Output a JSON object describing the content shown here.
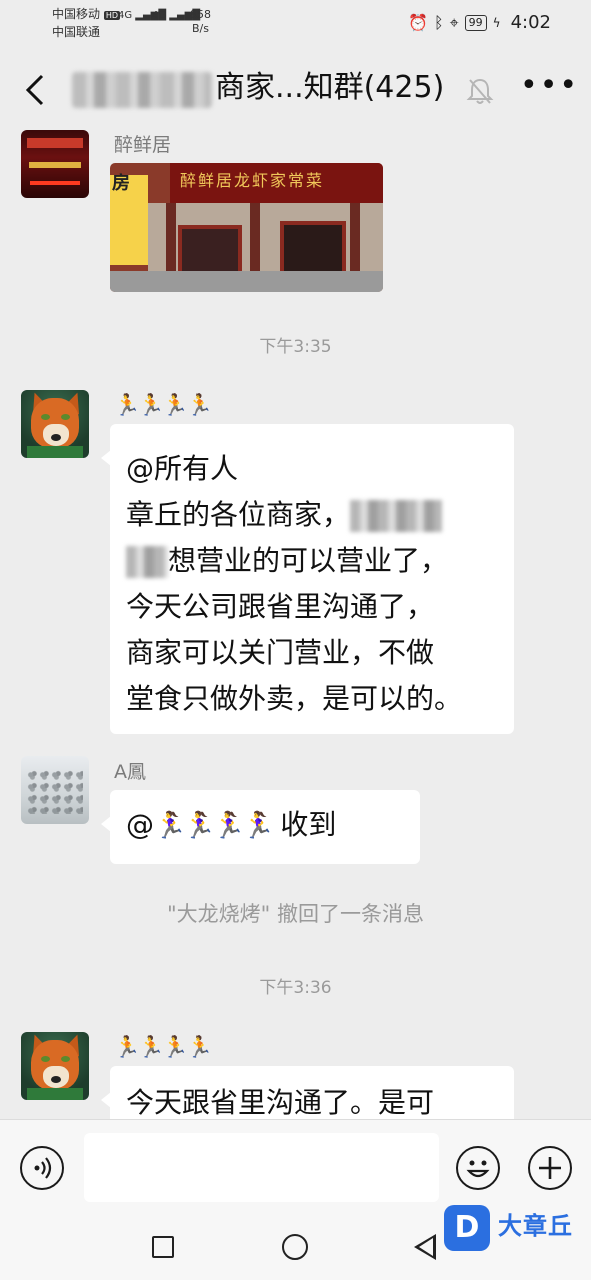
{
  "status_bar": {
    "carrier1": "中国移动",
    "carrier2": "中国联通",
    "hd": "HD",
    "net1": "4G",
    "net2": "4G",
    "speed_value": "858",
    "speed_unit": "B/s",
    "battery": "99",
    "time": "4:02"
  },
  "title_bar": {
    "back_label": "<",
    "title": "商家...知群(425)",
    "more_label": "•••"
  },
  "messages": [
    {
      "sender": "醉鲜居",
      "type": "image",
      "image_sign": "醉鲜居龙虾家常菜",
      "image_left_sign": "房"
    },
    {
      "type": "timestamp",
      "text": "下午3:35"
    },
    {
      "sender_emojis": "🏃🏃🏃🏃",
      "type": "text",
      "lines": [
        "@所有人",
        "章丘的各位商家，",
        "想营业的可以营业了，",
        "今天公司跟省里沟通了，",
        "商家可以关门营业，不做",
        "堂食只做外卖，是可以的。"
      ]
    },
    {
      "sender": "A鳳",
      "type": "text",
      "text_prefix": "@",
      "emojis": "🏃‍♀️🏃‍♀️🏃‍♀️🏃‍♀️",
      "text_suffix": " 收到"
    },
    {
      "type": "system",
      "text": "\"大龙烧烤\" 撤回了一条消息"
    },
    {
      "type": "timestamp",
      "text": "下午3:36"
    },
    {
      "sender_emojis": "🏃🏃🏃🏃",
      "type": "text",
      "lines": [
        "今天跟省里沟通了。是可"
      ]
    }
  ],
  "input_bar": {
    "voice_icon": "voice-icon",
    "emoji_icon": "emoji-icon",
    "plus_icon": "plus-icon",
    "emoji_glyph": "☺",
    "plus_glyph": "+",
    "voice_glyph": "◉)"
  },
  "watermark": {
    "logo": "D",
    "text": "大章丘"
  }
}
